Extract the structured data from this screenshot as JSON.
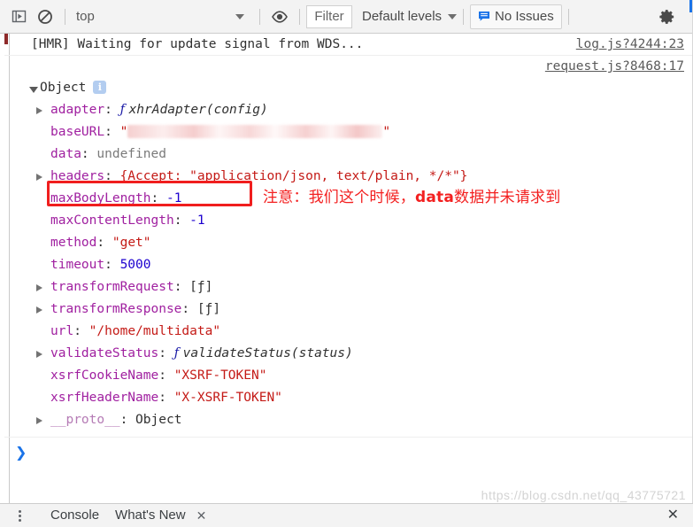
{
  "toolbar": {
    "sidebar_toggle_title": "show-console-sidebar",
    "clear_title": "clear-console",
    "context_value": "top",
    "eye_title": "live-expression",
    "filter_label": "Filter",
    "filter_placeholder": "Filter",
    "levels_label": "Default levels",
    "issues_label": "No Issues",
    "settings_title": "settings"
  },
  "messages": [
    {
      "text": "[HMR] Waiting for update signal from WDS...",
      "source": "log.js?4244:23"
    }
  ],
  "object_message": {
    "source": "request.js?8468:17",
    "root_label": "Object",
    "info_badge": "i",
    "properties": [
      {
        "expandable": true,
        "key": "adapter",
        "sep": ": ",
        "value": "xhrAdapter(config)",
        "kind": "function"
      },
      {
        "expandable": false,
        "key": "baseURL",
        "sep": ": ",
        "value": "\"███████████\"",
        "kind": "redacted"
      },
      {
        "expandable": false,
        "key": "data",
        "sep": ": ",
        "value": "undefined",
        "kind": "undefined"
      },
      {
        "expandable": true,
        "key": "headers",
        "sep": ": ",
        "value": "{Accept: \"application/json, text/plain, */*\"}",
        "kind": "object-preview"
      },
      {
        "expandable": false,
        "key": "maxBodyLength",
        "sep": ": ",
        "value": "-1",
        "kind": "number"
      },
      {
        "expandable": false,
        "key": "maxContentLength",
        "sep": ": ",
        "value": "-1",
        "kind": "number"
      },
      {
        "expandable": false,
        "key": "method",
        "sep": ": ",
        "value": "\"get\"",
        "kind": "string"
      },
      {
        "expandable": false,
        "key": "timeout",
        "sep": ": ",
        "value": "5000",
        "kind": "number"
      },
      {
        "expandable": true,
        "key": "transformRequest",
        "sep": ": ",
        "value": "[ƒ]",
        "kind": "array"
      },
      {
        "expandable": true,
        "key": "transformResponse",
        "sep": ": ",
        "value": "[ƒ]",
        "kind": "array"
      },
      {
        "expandable": false,
        "key": "url",
        "sep": ": ",
        "value": "\"/home/multidata\"",
        "kind": "string"
      },
      {
        "expandable": true,
        "key": "validateStatus",
        "sep": ": ",
        "value": "validateStatus(status)",
        "kind": "function"
      },
      {
        "expandable": false,
        "key": "xsrfCookieName",
        "sep": ": ",
        "value": "\"XSRF-TOKEN\"",
        "kind": "string"
      },
      {
        "expandable": false,
        "key": "xsrfHeaderName",
        "sep": ": ",
        "value": "\"X-XSRF-TOKEN\"",
        "kind": "string"
      },
      {
        "expandable": true,
        "key": "__proto__",
        "sep": ": ",
        "value": "Object",
        "kind": "proto"
      }
    ]
  },
  "annotation": {
    "prefix": "注意：我们这个时候，",
    "bold": "data",
    "suffix": "数据并未请求到",
    "color": "#f32020"
  },
  "prompt": {
    "chevron": "❯",
    "value": ""
  },
  "watermark": "https://blog.csdn.net/qq_43775721",
  "drawer": {
    "tabs": [
      {
        "label": "Console",
        "closable": false
      },
      {
        "label": "What's New",
        "closable": true
      }
    ],
    "close_label": "✕"
  },
  "colors": {
    "accent_blue": "#1a73e8",
    "annotation_red": "#f32020",
    "highlight_box": "#f01e1e",
    "key_purple": "#a020a0",
    "string_red": "#c41a16",
    "number_blue": "#1c00cf"
  }
}
